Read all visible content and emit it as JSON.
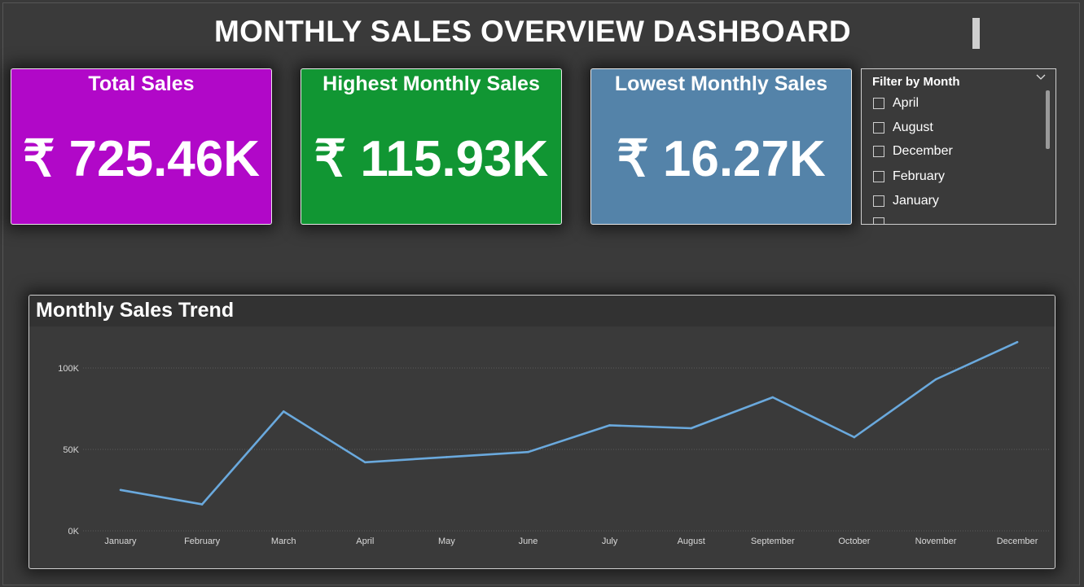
{
  "dashboard": {
    "title": "MONTHLY SALES OVERVIEW DASHBOARD"
  },
  "kpis": {
    "total": {
      "title": "Total Sales",
      "value": "₹ 725.46K",
      "color": "#b108c8"
    },
    "highest": {
      "title": "Highest Monthly Sales",
      "value": "₹ 115.93K",
      "color": "#119633"
    },
    "lowest": {
      "title": "Lowest Monthly Sales",
      "value": "₹ 16.27K",
      "color": "#5483a9"
    }
  },
  "filter": {
    "title": "Filter by Month",
    "items": [
      "April",
      "August",
      "December",
      "February",
      "January"
    ]
  },
  "chart_data": {
    "type": "line",
    "title": "Monthly Sales Trend",
    "categories": [
      "January",
      "February",
      "March",
      "April",
      "May",
      "June",
      "July",
      "August",
      "September",
      "October",
      "November",
      "December"
    ],
    "series": [
      {
        "values": [
          25100,
          16270,
          73300,
          42100,
          45300,
          48400,
          64800,
          63000,
          82000,
          57500,
          93000,
          115930
        ],
        "color": "#6aa9dd"
      }
    ],
    "ylim": [
      0,
      120000
    ],
    "yticks": [
      0,
      50000,
      100000
    ],
    "ytick_labels": [
      "0K",
      "50K",
      "100K"
    ],
    "grid": true,
    "legend": "none"
  }
}
